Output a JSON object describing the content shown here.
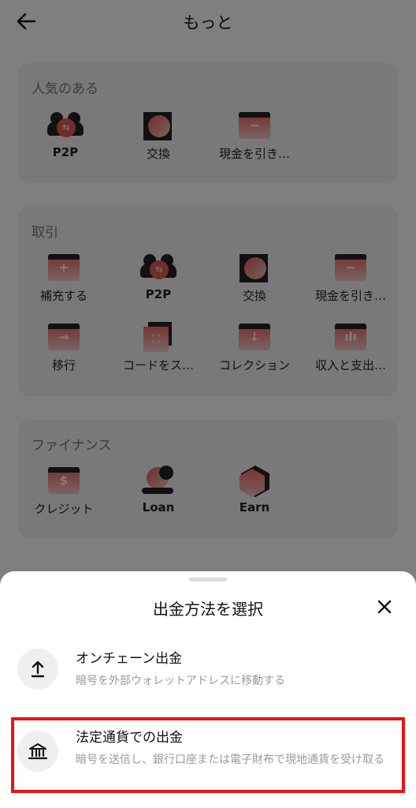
{
  "header": {
    "title": "もっと"
  },
  "popular": {
    "title": "人気のある",
    "items": [
      {
        "label": "P2P",
        "icon": "p2p-icon"
      },
      {
        "label": "交換",
        "icon": "exchange-icon"
      },
      {
        "label": "現金を引き…",
        "icon": "withdraw-cash-icon"
      }
    ]
  },
  "trade": {
    "title": "取引",
    "items": [
      {
        "label": "補充する",
        "icon": "deposit-icon"
      },
      {
        "label": "P2P",
        "icon": "p2p-icon"
      },
      {
        "label": "交換",
        "icon": "exchange-icon"
      },
      {
        "label": "現金を引き…",
        "icon": "withdraw-cash-icon"
      },
      {
        "label": "移行",
        "icon": "transfer-icon"
      },
      {
        "label": "コードをス…",
        "icon": "scan-code-icon"
      },
      {
        "label": "コレクション",
        "icon": "collection-icon"
      },
      {
        "label": "収入と支出…",
        "icon": "income-expense-icon"
      }
    ]
  },
  "finance": {
    "title": "ファイナンス",
    "items": [
      {
        "label": "クレジット",
        "icon": "credit-icon"
      },
      {
        "label": "Loan",
        "icon": "loan-icon"
      },
      {
        "label": "Earn",
        "icon": "earn-icon"
      }
    ]
  },
  "sheet": {
    "title": "出金方法を選択",
    "options": [
      {
        "title": "オンチェーン出金",
        "desc": "暗号を外部ウォレットアドレスに移動する",
        "icon": "upload-icon"
      },
      {
        "title": "法定通貨での出金",
        "desc": "暗号を送信し、銀行口座または電子財布で現地通貨を受け取る",
        "icon": "bank-icon"
      }
    ]
  },
  "colors": {
    "accent": "#e25a5a",
    "highlight": "#ee1111",
    "overlay": "rgba(0,0,0,0.5)"
  }
}
